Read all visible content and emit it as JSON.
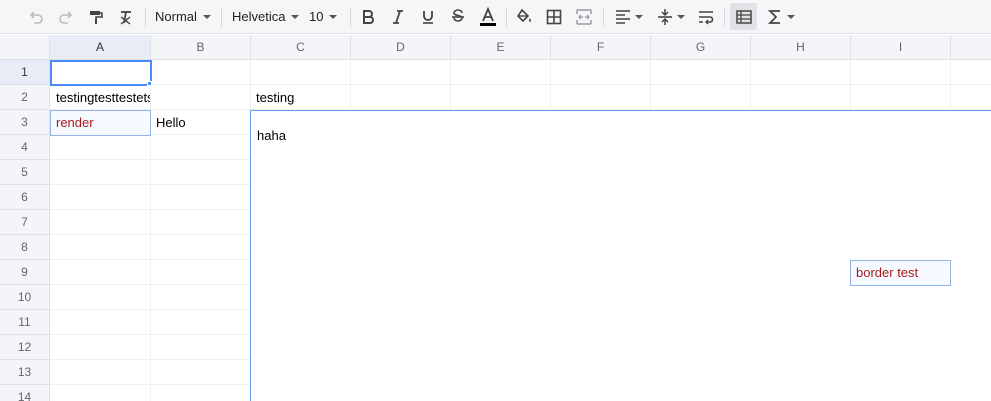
{
  "toolbar": {
    "style_select": "Normal",
    "font_select": "Helvetica",
    "size_select": "10",
    "icons": [
      "undo-icon",
      "redo-icon",
      "paint-format-icon",
      "clear-format-icon",
      "bold-icon",
      "italic-icon",
      "underline-icon",
      "strikethrough-icon",
      "text-color-icon",
      "fill-color-icon",
      "borders-icon",
      "merge-cells-icon",
      "align-icon",
      "valign-icon",
      "wrap-text-icon",
      "freeze-icon",
      "sum-icon"
    ]
  },
  "sheet": {
    "columns": [
      "A",
      "B",
      "C",
      "D",
      "E",
      "F",
      "G",
      "H",
      "I"
    ],
    "rows": [
      "1",
      "2",
      "3",
      "4",
      "5",
      "6",
      "7",
      "8",
      "9",
      "10",
      "11",
      "12",
      "13",
      "14"
    ],
    "cells": {
      "a2": "testingtesttestetsetset",
      "c2": "testing",
      "a3": "render",
      "b3": "Hello",
      "c3": "haha",
      "i9": "border test"
    }
  },
  "colors": {
    "selection": "#4b89ff",
    "red_text": "#a61c1c",
    "merged_border": "#6c9be6"
  }
}
